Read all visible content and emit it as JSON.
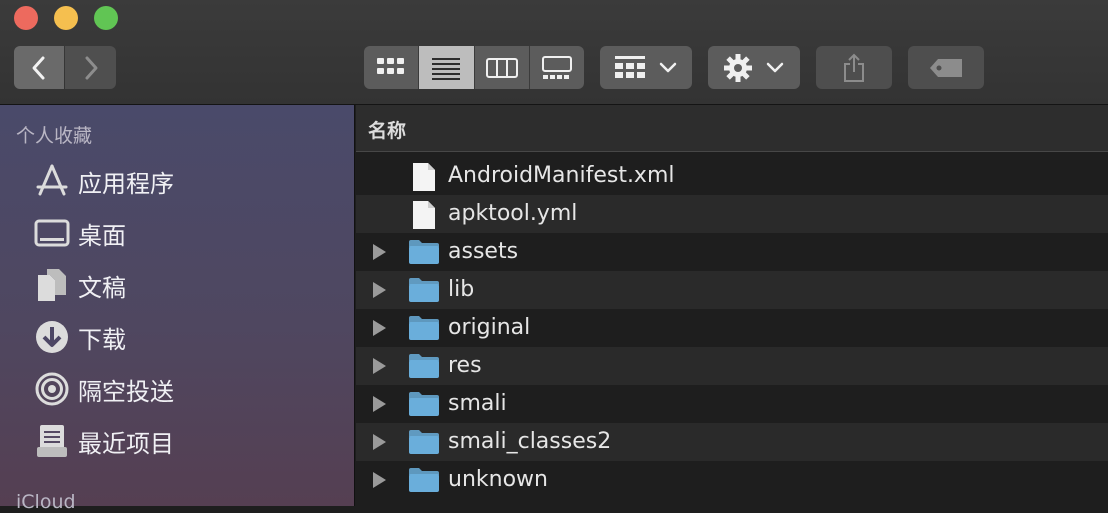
{
  "window": {
    "traffic_lights": [
      "close",
      "minimize",
      "zoom"
    ],
    "colors": {
      "close": "#ed6a5e",
      "minimize": "#f5bf4f",
      "zoom": "#61c554"
    }
  },
  "toolbar": {
    "nav": [
      {
        "icon": "chevron-left-icon"
      },
      {
        "icon": "chevron-right-icon"
      }
    ],
    "view_modes": [
      {
        "icon": "icon-view-icon",
        "active": false
      },
      {
        "icon": "list-view-icon",
        "active": true
      },
      {
        "icon": "column-view-icon",
        "active": false
      },
      {
        "icon": "gallery-view-icon",
        "active": false
      }
    ],
    "group_icon": "group-by-icon",
    "action_icon": "gear-icon",
    "share_icon": "share-icon",
    "tag_icon": "tag-icon"
  },
  "sidebar": {
    "favorites_title": "个人收藏",
    "items": [
      {
        "label": "应用程序",
        "icon": "applications-icon"
      },
      {
        "label": "桌面",
        "icon": "desktop-icon"
      },
      {
        "label": "文稿",
        "icon": "documents-icon"
      },
      {
        "label": "下载",
        "icon": "downloads-icon"
      },
      {
        "label": "隔空投送",
        "icon": "airdrop-icon"
      },
      {
        "label": "最近项目",
        "icon": "recents-icon"
      }
    ],
    "icloud_title": "iCloud"
  },
  "list": {
    "column_header": "名称",
    "rows": [
      {
        "name": "AndroidManifest.xml",
        "type": "file"
      },
      {
        "name": "apktool.yml",
        "type": "file"
      },
      {
        "name": "assets",
        "type": "folder"
      },
      {
        "name": "lib",
        "type": "folder"
      },
      {
        "name": "original",
        "type": "folder"
      },
      {
        "name": "res",
        "type": "folder"
      },
      {
        "name": "smali",
        "type": "folder"
      },
      {
        "name": "smali_classes2",
        "type": "folder"
      },
      {
        "name": "unknown",
        "type": "folder"
      }
    ],
    "folder_color": "#6aaedb"
  }
}
